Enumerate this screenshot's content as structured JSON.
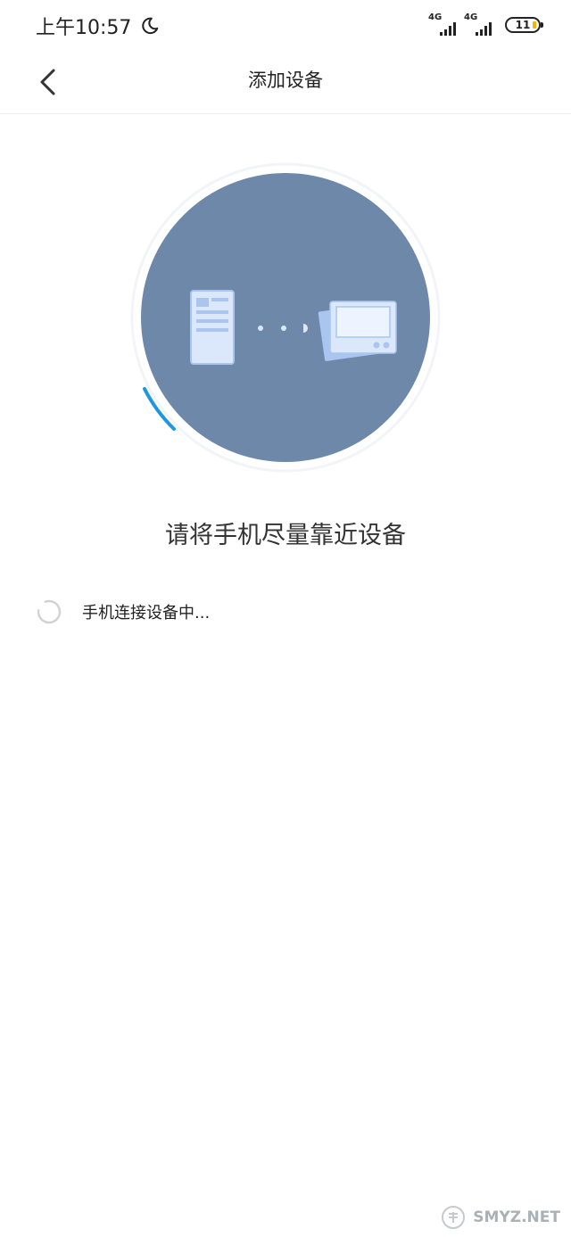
{
  "status_bar": {
    "time": "上午10:57",
    "network_1": "4G",
    "network_2": "4G",
    "battery": "11",
    "icons": [
      "moon-icon",
      "signal-icon",
      "signal-icon",
      "battery-icon"
    ]
  },
  "nav": {
    "title": "添加设备",
    "back_icon": "chevron-left-icon"
  },
  "illustration": {
    "icons": [
      "phone-icon",
      "device-icon"
    ],
    "colors": {
      "circle": "#6e88a9",
      "accent": "#1e96e0",
      "device_fill": "#dbe8fb"
    }
  },
  "main": {
    "prompt": "请将手机尽量靠近设备",
    "status_text": "手机连接设备中..."
  },
  "watermark": {
    "site": "SMYZ.NET"
  }
}
